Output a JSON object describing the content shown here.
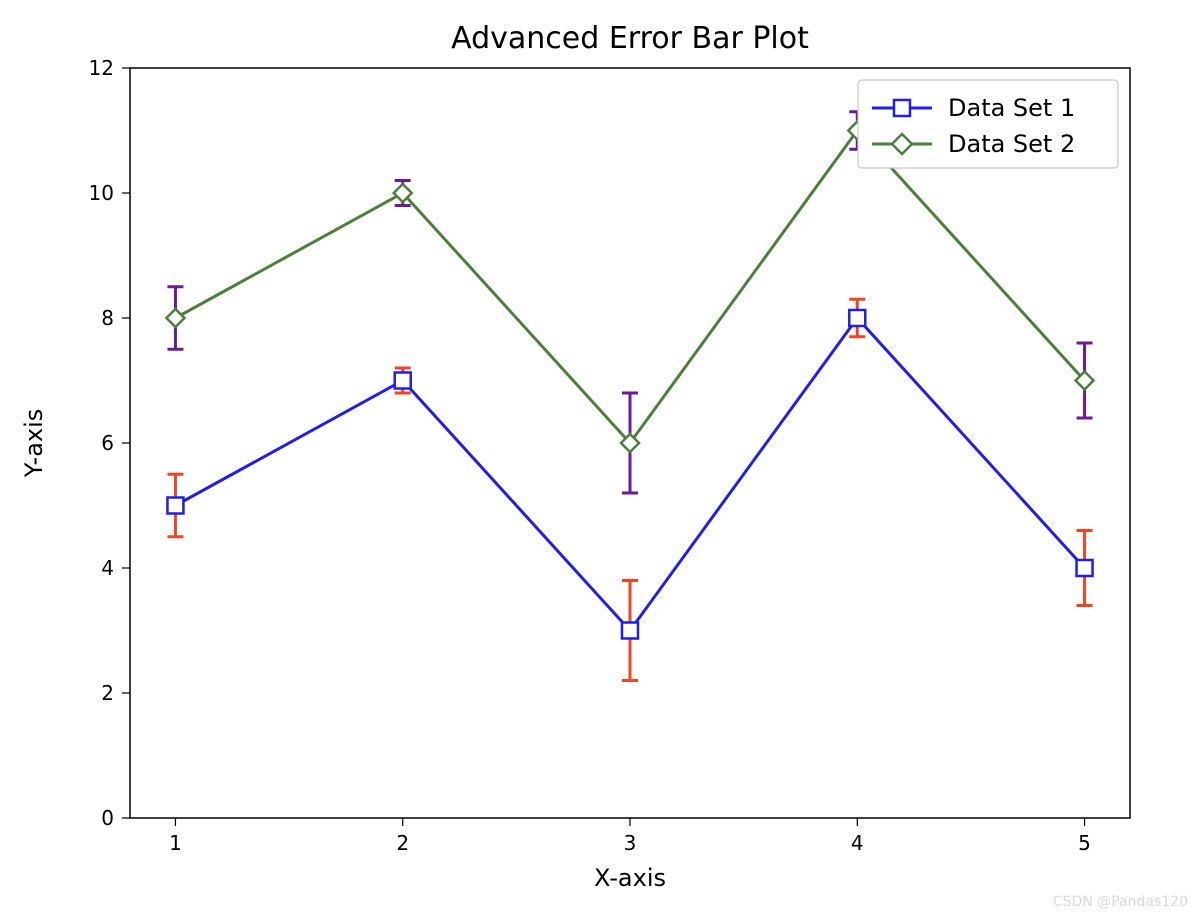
{
  "chart_data": {
    "type": "line",
    "title": "Advanced Error Bar Plot",
    "xlabel": "X-axis",
    "ylabel": "Y-axis",
    "xticks": [
      1,
      2,
      3,
      4,
      5
    ],
    "yticks": [
      0,
      2,
      4,
      6,
      8,
      10,
      12
    ],
    "xlim": [
      0.8,
      5.2
    ],
    "ylim": [
      0,
      12
    ],
    "x": [
      1,
      2,
      3,
      4,
      5
    ],
    "series": [
      {
        "name": "Data Set 1",
        "y": [
          5.0,
          7.0,
          3.0,
          8.0,
          4.0
        ],
        "err": [
          0.5,
          0.2,
          0.8,
          0.3,
          0.6
        ],
        "line_color": "#1f1fe6",
        "marker": "square",
        "marker_fill": "#ffffff",
        "marker_edge": "#1f1fe6",
        "marker_size": 16,
        "error_color": "#ef4523"
      },
      {
        "name": "Data Set 2",
        "y": [
          8.0,
          10.0,
          6.0,
          11.0,
          7.0
        ],
        "err": [
          0.5,
          0.2,
          0.8,
          0.3,
          0.6
        ],
        "line_color": "#4c7f3c",
        "marker": "diamond",
        "marker_fill": "#ffffff",
        "marker_edge": "#4c7f3c",
        "marker_size": 18,
        "error_color": "#6a1b9a"
      }
    ],
    "legend_loc": "upper right",
    "watermark": "CSDN @Pandas120"
  }
}
